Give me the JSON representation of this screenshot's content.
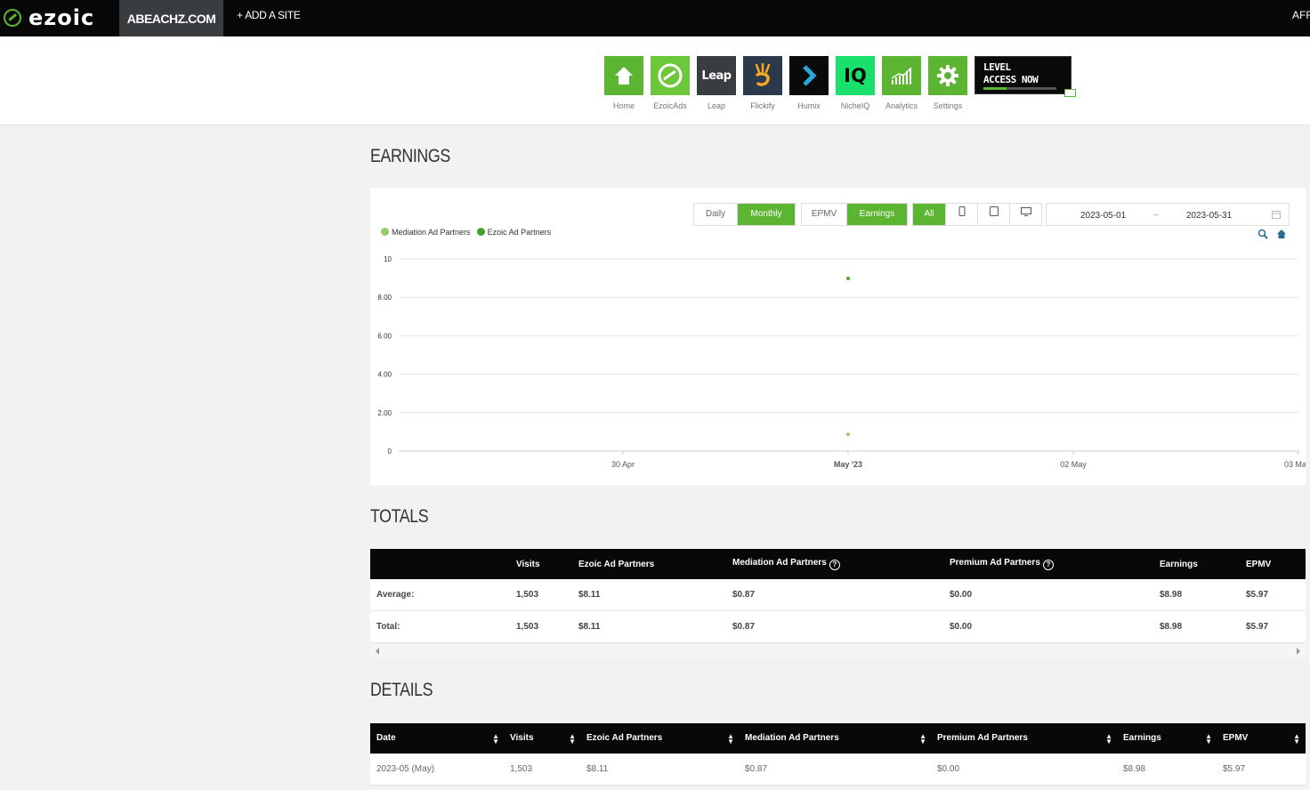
{
  "topbar": {
    "logo_text": "ezoic",
    "site_name": "ABEACHZ.COM",
    "add_site": "+ ADD A SITE",
    "right_label": "AFFI"
  },
  "apps": [
    {
      "label": "Home",
      "color": "#5cb531"
    },
    {
      "label": "EzoicAds",
      "color": "#6cc83a"
    },
    {
      "label": "Leap",
      "color": "#3a3d40"
    },
    {
      "label": "Flickify",
      "color": "#2a3a4a"
    },
    {
      "label": "Humix",
      "color": "#0a0a0a"
    },
    {
      "label": "NicheIQ",
      "color": "#19e06a"
    },
    {
      "label": "Analytics",
      "color": "#5cb531"
    },
    {
      "label": "Settings",
      "color": "#5cb531"
    }
  ],
  "app_glyphs": {
    "leap": "Leap",
    "nicheiq": "IQ"
  },
  "level_access": {
    "line1": "LEVEL",
    "line2": "ACCESS NOW"
  },
  "earnings": {
    "title": "EARNINGS",
    "period_buttons": [
      "Daily",
      "Monthly"
    ],
    "metric_buttons": [
      "EPMV",
      "Earnings"
    ],
    "device_buttons": {
      "all": "All"
    },
    "date_start": "2023-05-01",
    "date_sep": "~",
    "date_end": "2023-05-31",
    "legend": [
      "Mediation Ad Partners",
      "Ezoic Ad Partners"
    ]
  },
  "chart_data": {
    "type": "scatter",
    "x": [
      "30 Apr",
      "May '23",
      "02 May",
      "03 Ma"
    ],
    "series": [
      {
        "name": "Mediation Ad Partners",
        "points": [
          {
            "x": "May '23",
            "y": 0.87
          }
        ],
        "color": "#8fce6b"
      },
      {
        "name": "Ezoic Ad Partners",
        "points": [
          {
            "x": "May '23",
            "y": 8.98
          }
        ],
        "color": "#4aa02c"
      }
    ],
    "yticks": [
      "0",
      "2.00",
      "4.00",
      "6.00",
      "8.00",
      "10"
    ],
    "ylim": [
      0,
      10
    ],
    "grid": true,
    "legend": "top-left"
  },
  "totals": {
    "title": "TOTALS",
    "headers": [
      "",
      "Visits",
      "Ezoic Ad Partners",
      "Mediation Ad Partners",
      "Premium Ad Partners",
      "Earnings",
      "EPMV"
    ],
    "help_mark": "?",
    "rows": [
      [
        "Average:",
        "1,503",
        "$8.11",
        "$0.87",
        "$0.00",
        "$8.98",
        "$5.97"
      ],
      [
        "Total:",
        "1,503",
        "$8.11",
        "$0.87",
        "$0.00",
        "$8.98",
        "$5.97"
      ]
    ]
  },
  "details": {
    "title": "DETAILS",
    "headers": [
      "Date",
      "Visits",
      "Ezoic Ad Partners",
      "Mediation Ad Partners",
      "Premium Ad Partners",
      "Earnings",
      "EPMV"
    ],
    "rows": [
      [
        "2023-05 (May)",
        "1,503",
        "$8.11",
        "$0.87",
        "$0.00",
        "$8.98",
        "$5.97"
      ]
    ]
  }
}
